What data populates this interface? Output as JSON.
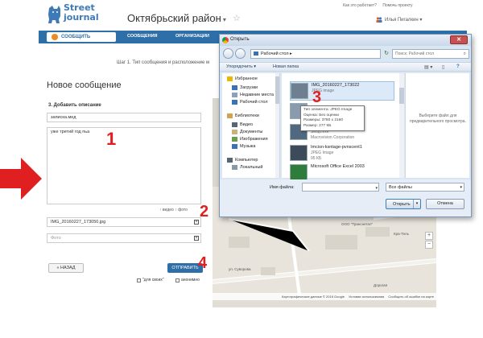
{
  "header": {
    "logo_line1": "Street",
    "logo_line2": "journal",
    "region_title": "Октябрьский район",
    "region_caret": "▾",
    "star": "☆",
    "top_links": [
      "Как это работает?",
      "Помочь проекту"
    ],
    "user_name": "Илья Пигалкин ▾"
  },
  "nav": {
    "primary": "СООБЩИТЬ",
    "items": [
      "СООБЩЕНИЯ",
      "ОРГАНИЗАЦИИ"
    ]
  },
  "step_text": "Шаг 1. Тип сообщения и расположение м",
  "form": {
    "title": "Новое сообщение",
    "section_label": "3. Добавить описание",
    "short_desc": "записка.мед",
    "long_desc": "уже третий год пьа",
    "upload_links": "↑ видео    ↑ фото",
    "file_value": "IMG_20160227_173050.jpg",
    "photo_placeholder": "Фото",
    "x_mark": "×",
    "back_button": "« НАЗАД",
    "send_button": "ОТПРАВИТЬ",
    "checkbox1": "\"для своих\"",
    "checkbox2": "анонимно"
  },
  "annotations": {
    "n1": "1",
    "n2": "2",
    "n3": "3",
    "n4": "4",
    "arrow_color": "#e02020"
  },
  "map": {
    "labels": [
      "ООО \"Транснетал\"",
      "Кра-Тель",
      "ул. Суворова",
      "Дорогая"
    ],
    "footer": [
      "Картографические данные © 2016 Google",
      "Условия использования",
      "Сообщить об ошибке на карте"
    ],
    "zoom_in": "+",
    "zoom_out": "−"
  },
  "dialog": {
    "title": "Открыть",
    "close": "✕",
    "path": "Рабочий стол ▸",
    "refresh": "↻",
    "search_placeholder": "Поиск: Рабочий стол",
    "search_icon": "⌕",
    "toolbar": {
      "organize": "Упорядочить ▾",
      "new_folder": "Новая папка",
      "view_icon": "▤ ▾",
      "preview_icon": "▯",
      "help_icon": "?"
    },
    "nav_pane": [
      {
        "label": "Избранное",
        "sub": false,
        "icon": "star-icon",
        "color": "#e8b800"
      },
      {
        "label": "Загрузки",
        "sub": true,
        "icon": "download-folder-icon",
        "color": "#3a72b8"
      },
      {
        "label": "Недавние места",
        "sub": true,
        "icon": "recent-places-icon",
        "color": "#8aa0bb"
      },
      {
        "label": "Рабочий стол",
        "sub": true,
        "icon": "desktop-icon",
        "color": "#3a72b8"
      },
      {
        "label": "Библиотеки",
        "sub": false,
        "icon": "library-icon",
        "color": "#d4a24a"
      },
      {
        "label": "Видео",
        "sub": true,
        "icon": "video-icon",
        "color": "#556677"
      },
      {
        "label": "Документы",
        "sub": true,
        "icon": "documents-icon",
        "color": "#c9b37a"
      },
      {
        "label": "Изображения",
        "sub": true,
        "icon": "pictures-icon",
        "color": "#6b9e4a"
      },
      {
        "label": "Музыка",
        "sub": true,
        "icon": "music-icon",
        "color": "#3a72b8"
      },
      {
        "label": "Компьютер",
        "sub": false,
        "icon": "computer-icon",
        "color": "#556677"
      },
      {
        "label": "Локальный",
        "sub": true,
        "icon": "drive-icon",
        "color": "#8899aa"
      }
    ],
    "files": [
      {
        "name": "IMG_20160227_173022",
        "type": "JPEG image",
        "size": "",
        "selected": true
      },
      {
        "name": "",
        "type": "",
        "size": "",
        "selected": false
      },
      {
        "name": "itemB10",
        "type": "Setup.exe",
        "size": "Macrovision Corporation",
        "selected": false
      },
      {
        "name": "Imcisn-ksntage-pvnscent1",
        "type": "JPEG Image",
        "size": "95 КБ",
        "selected": false
      },
      {
        "name": "Microsoft Office Excel 2003",
        "type": "",
        "size": "",
        "selected": false
      }
    ],
    "tooltip": [
      "Тип элемента: JPEG Image",
      "Оценка: Без оценки",
      "Размеры: 3780 x 2160",
      "Размер: 277 КБ"
    ],
    "preview_text": "Выберите файл для предварительного просмотра.",
    "filename_label": "Имя файла:",
    "filetype": "Все файлы",
    "dropdown_caret": "▾",
    "open_button": "Открыть",
    "cancel_button": "Отмена"
  }
}
